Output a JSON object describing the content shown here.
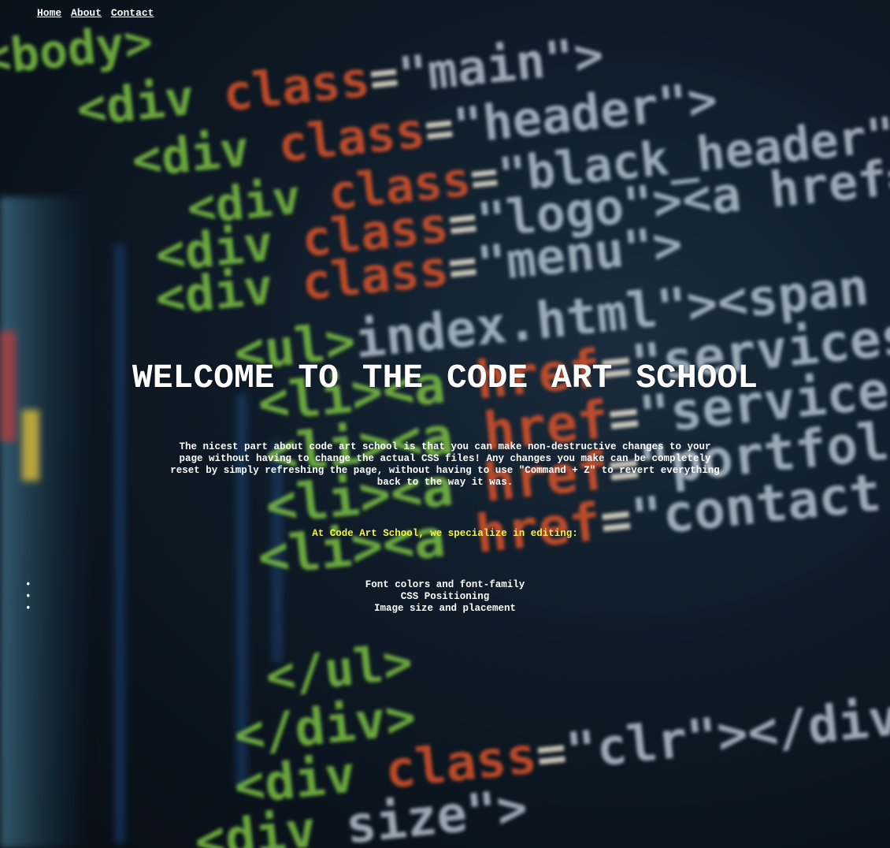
{
  "nav": {
    "items": [
      {
        "label": "Home"
      },
      {
        "label": "About"
      },
      {
        "label": "Contact"
      }
    ]
  },
  "hero": {
    "title": "WELCOME TO THE CODE ART SCHOOL",
    "intro": "The nicest part about code art school is that you can make non-destructive changes to your page without having to change the actual CSS files! Any changes you make can be completely reset by simply refreshing the page, without having to use \"Command + Z\" to revert everything back to the way it was.",
    "specialize": "At Code Art School, we specialize in editing:",
    "skills": [
      "Font colors and font-family",
      "CSS Positioning",
      "Image size and placement"
    ]
  },
  "background_image": {
    "code_lines": [
      {
        "tag": "<body>",
        "attr": "",
        "val": ""
      },
      {
        "tag": "<div ",
        "attr": "class",
        "val": "\"main\">"
      },
      {
        "tag": "<div ",
        "attr": "class",
        "val": "\"header\">"
      },
      {
        "tag": "<div ",
        "attr": "class",
        "val": "\"black_header\">"
      },
      {
        "tag": "<div ",
        "attr": "class",
        "val": "\"logo\"><a href=\"index.htm"
      },
      {
        "tag": "<div ",
        "attr": "class",
        "val": "\"menu\">"
      },
      {
        "tag": "<ul>",
        "attr": "",
        "val": "index.html\"><span"
      },
      {
        "tag": "<li><a ",
        "attr": "href",
        "val": "\"services.html\"><"
      },
      {
        "tag": "<li><a ",
        "attr": "href",
        "val": "\"services.html\"><"
      },
      {
        "tag": "<li><a ",
        "attr": "href",
        "val": "\"portfolio.html\"><"
      },
      {
        "tag": "<li><a ",
        "attr": "href",
        "val": "\"contact.html\"><"
      },
      {
        "tag": "</ul>",
        "attr": "",
        "val": ""
      },
      {
        "tag": "</div>",
        "attr": "",
        "val": ""
      },
      {
        "tag": "<div ",
        "attr": "class",
        "val": "\"clr\"></div>"
      },
      {
        "tag": "<div ",
        "attr": "",
        "val": "size\">"
      }
    ],
    "colors": {
      "tag": "#7bc043",
      "attr": "#d9532b",
      "value": "#b6c4cf",
      "equals": "#e8e2cf",
      "accent_yellow": "#f5f542"
    }
  }
}
